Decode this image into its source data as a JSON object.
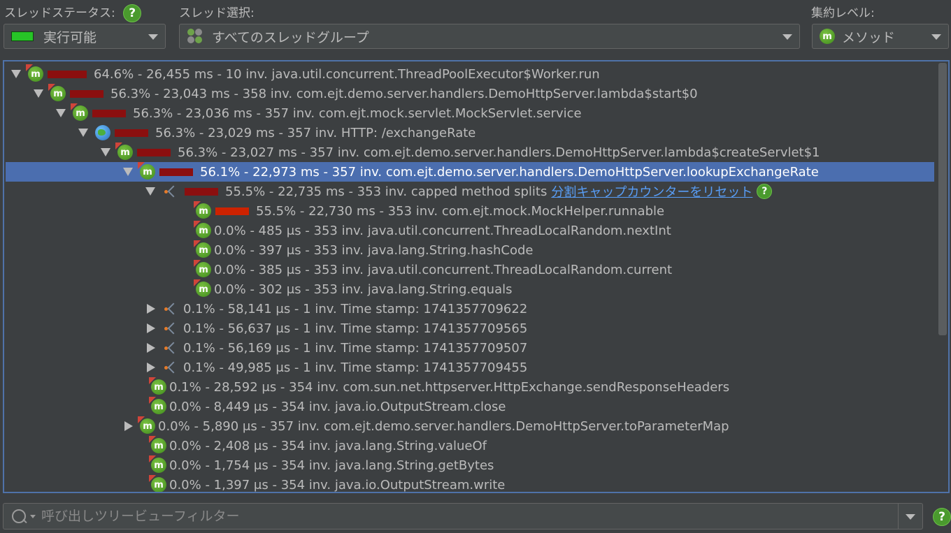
{
  "toolbar": {
    "thread_status_label": "スレッドステータス:",
    "thread_status_value": "実行可能",
    "thread_select_label": "スレッド選択:",
    "thread_select_value": "すべてのスレッドグループ",
    "aggregation_label": "集約レベル:",
    "aggregation_value": "メソッド",
    "help_glyph": "?"
  },
  "colors": {
    "accent": "#4b6eaf",
    "status_runnable": "#27c427",
    "hot_bar": "#8b0f0f",
    "link": "#589df6"
  },
  "tree": {
    "rows": [
      {
        "text": "64.6% - 26,455 ms - 10 inv. java.util.concurrent.ThreadPoolExecutor$Worker.run",
        "toggle": "open",
        "icon": "method-icon",
        "bar": 0.646
      },
      {
        "text": "56.3% - 23,043 ms - 358 inv. com.ejt.demo.server.handlers.DemoHttpServer.lambda$start$0",
        "toggle": "open",
        "icon": "method-icon",
        "bar": 0.563
      },
      {
        "text": "56.3% - 23,036 ms - 357 inv. com.ejt.mock.servlet.MockServlet.service",
        "toggle": "open",
        "icon": "method-icon",
        "bar": 0.563
      },
      {
        "text": "56.3% - 23,029 ms - 357 inv. HTTP: /exchangeRate",
        "toggle": "open",
        "icon": "globe-icon",
        "bar": 0.563
      },
      {
        "text": "56.3% - 23,027 ms - 357 inv. com.ejt.demo.server.handlers.DemoHttpServer.lambda$createServlet$1",
        "toggle": "open",
        "icon": "method-icon",
        "bar": 0.563
      },
      {
        "text": "56.1% - 22,973 ms - 357 inv. com.ejt.demo.server.handlers.DemoHttpServer.lookupExchangeRate",
        "toggle": "open",
        "icon": "method-icon",
        "bar": 0.561,
        "selected": true
      },
      {
        "text": "55.5% - 22,735 ms - 353 inv. capped method splits",
        "toggle": "open",
        "icon": "split-icon",
        "bar": 0.555,
        "link": "分割キャップカウンターをリセット",
        "help": true
      },
      {
        "text": "55.5% - 22,730 ms - 353 inv. com.ejt.mock.MockHelper.runnable",
        "toggle": "none",
        "icon": "method-icon",
        "bar": 0.555,
        "hot": true
      },
      {
        "text": "0.0% - 485 μs - 353 inv. java.util.concurrent.ThreadLocalRandom.nextInt",
        "toggle": "none",
        "icon": "method-icon",
        "bar": 0
      },
      {
        "text": "0.0% - 397 μs - 353 inv. java.lang.String.hashCode",
        "toggle": "none",
        "icon": "method-icon",
        "bar": 0
      },
      {
        "text": "0.0% - 385 μs - 353 inv. java.util.concurrent.ThreadLocalRandom.current",
        "toggle": "none",
        "icon": "method-icon",
        "bar": 0
      },
      {
        "text": "0.0% - 302 μs - 353 inv. java.lang.String.equals",
        "toggle": "none",
        "icon": "method-icon",
        "bar": 0
      },
      {
        "text": "0.1% - 58,141 μs - 1 inv. Time stamp: 1741357709622",
        "toggle": "closed",
        "icon": "split-icon",
        "bar": 0
      },
      {
        "text": "0.1% - 56,637 μs - 1 inv. Time stamp: 1741357709565",
        "toggle": "closed",
        "icon": "split-icon",
        "bar": 0
      },
      {
        "text": "0.1% - 56,169 μs - 1 inv. Time stamp: 1741357709507",
        "toggle": "closed",
        "icon": "split-icon",
        "bar": 0
      },
      {
        "text": "0.1% - 49,985 μs - 1 inv. Time stamp: 1741357709455",
        "toggle": "closed",
        "icon": "split-icon",
        "bar": 0
      },
      {
        "text": "0.1% - 28,592 μs - 354 inv. com.sun.net.httpserver.HttpExchange.sendResponseHeaders",
        "toggle": "none",
        "icon": "method-icon",
        "bar": 0
      },
      {
        "text": "0.0% - 8,449 μs - 354 inv. java.io.OutputStream.close",
        "toggle": "none",
        "icon": "method-icon",
        "bar": 0
      },
      {
        "text": "0.0% - 5,890 μs - 357 inv. com.ejt.demo.server.handlers.DemoHttpServer.toParameterMap",
        "toggle": "closed",
        "icon": "method-icon",
        "bar": 0
      },
      {
        "text": "0.0% - 2,408 μs - 354 inv. java.lang.String.valueOf",
        "toggle": "none",
        "icon": "method-icon",
        "bar": 0
      },
      {
        "text": "0.0% - 1,754 μs - 354 inv. java.lang.String.getBytes",
        "toggle": "none",
        "icon": "method-icon",
        "bar": 0
      },
      {
        "text": "0.0% - 1,397 μs - 354 inv. java.io.OutputStream.write",
        "toggle": "none",
        "icon": "method-icon",
        "bar": 0
      }
    ]
  },
  "filter": {
    "placeholder": "呼び出しツリービューフィルター"
  }
}
